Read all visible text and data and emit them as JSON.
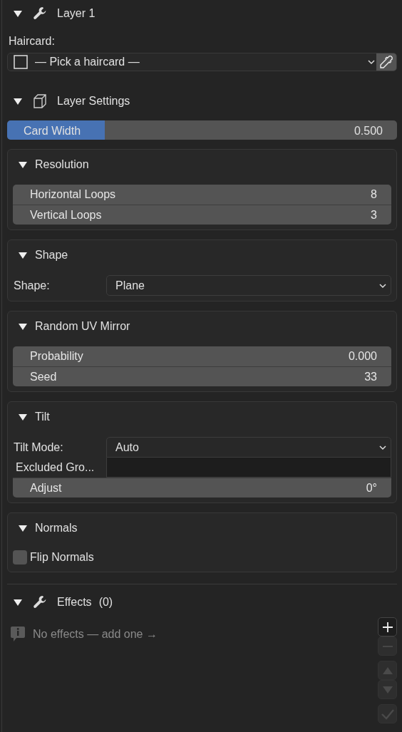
{
  "layer": {
    "title": "Layer 1",
    "expanded": true
  },
  "haircard": {
    "label": "Haircard:",
    "value": "— Pick a haircard —"
  },
  "layer_settings": {
    "title": "Layer Settings",
    "expanded": true,
    "card_width": {
      "label": "Card Width",
      "value": "0.500",
      "level": 0.25
    }
  },
  "sections": [
    {
      "title": "Resolution",
      "expanded": true,
      "rows": [
        {
          "kind": "number",
          "label": "Horizontal Loops",
          "value": "8"
        },
        {
          "kind": "number",
          "label": "Vertical Loops",
          "value": "3"
        }
      ]
    },
    {
      "title": "Shape",
      "expanded": true,
      "rows": [
        {
          "kind": "dropdown",
          "label": "Shape:",
          "value": "Plane"
        }
      ]
    },
    {
      "title": "Random UV Mirror",
      "expanded": true,
      "rows": [
        {
          "kind": "number",
          "label": "Probability",
          "value": "0.000"
        },
        {
          "kind": "number",
          "label": "Seed",
          "value": "33"
        }
      ]
    },
    {
      "title": "Tilt",
      "expanded": true,
      "rows": [
        {
          "kind": "dropdown",
          "label": "Tilt Mode:",
          "value": "Auto"
        },
        {
          "kind": "text",
          "label": "Excluded Gro..."
        },
        {
          "kind": "number",
          "label": "Adjust",
          "value": "0°"
        }
      ]
    },
    {
      "title": "Normals",
      "expanded": true,
      "rows": [
        {
          "kind": "checkbox",
          "label": "Flip Normals",
          "checked": false
        }
      ]
    }
  ],
  "effects": {
    "title": "Effects",
    "count": "(0)",
    "expanded": true,
    "empty_message": "No effects — add one →",
    "buttons": [
      {
        "kind": "add",
        "disabled": false
      },
      {
        "kind": "remove",
        "disabled": true
      },
      {
        "kind": "up",
        "disabled": true
      },
      {
        "kind": "down",
        "disabled": true
      },
      {
        "kind": "apply",
        "disabled": true
      }
    ]
  }
}
